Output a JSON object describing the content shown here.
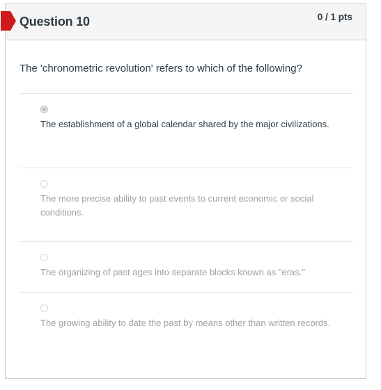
{
  "question": {
    "title": "Question 10",
    "points": "0 / 1 pts",
    "text": "The 'chronometric revolution' refers to which of the following?"
  },
  "answers": [
    {
      "text": "The establishment of a global calendar shared by the major civilizations.",
      "selected": true
    },
    {
      "text": "The more precise ability to past events to current economic or social conditions.",
      "selected": false
    },
    {
      "text": "The organizing of past ages into separate blocks known as \"eras.\"",
      "selected": false
    },
    {
      "text": "The growing ability to date the past by means other than written records.",
      "selected": false
    }
  ],
  "colors": {
    "flag": "#d0191a",
    "header_bg": "#f5f5f5",
    "text_dark": "#2d3b45",
    "text_muted": "#9aa1a6"
  }
}
